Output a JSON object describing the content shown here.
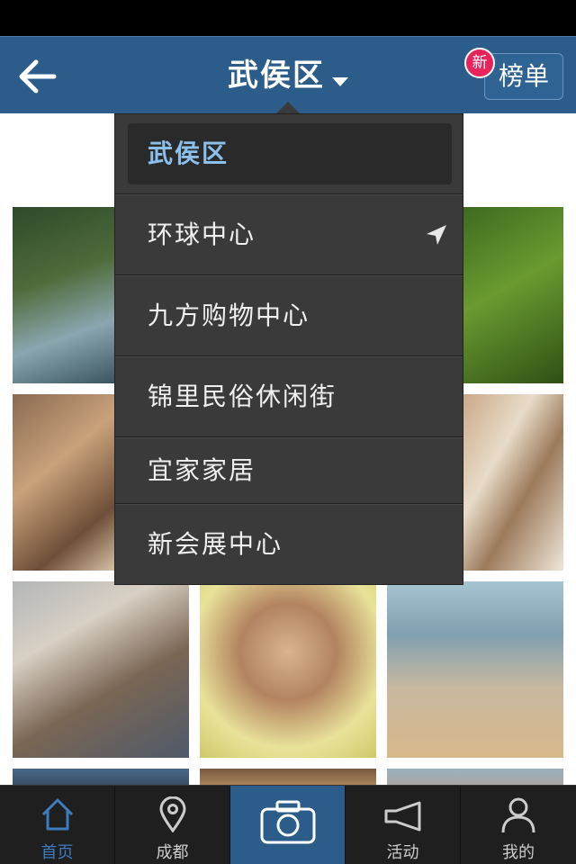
{
  "navbar": {
    "title": "武侯区",
    "rank_label": "榜单",
    "badge": "新"
  },
  "dropdown": {
    "selected": "武侯区",
    "items": [
      {
        "label": "环球中心",
        "icon": "location-arrow-icon"
      },
      {
        "label": "九方购物中心"
      },
      {
        "label": "锦里民俗休闲街"
      },
      {
        "label": "宜家家居"
      },
      {
        "label": "新会展中心"
      }
    ]
  },
  "tabbar": {
    "tabs": [
      {
        "label": "首页",
        "icon": "home-icon",
        "active": true
      },
      {
        "label": "成都",
        "icon": "location-pin-icon"
      },
      {
        "label": "",
        "icon": "camera-icon"
      },
      {
        "label": "活动",
        "icon": "megaphone-icon"
      },
      {
        "label": "我的",
        "icon": "user-icon"
      }
    ]
  },
  "colors": {
    "navbar": "#2c5d8a",
    "accent": "#3d7cc0",
    "badge": "#e8225a",
    "dropdown_bg": "#3a3a3a",
    "selected_text": "#8cc0ec"
  }
}
